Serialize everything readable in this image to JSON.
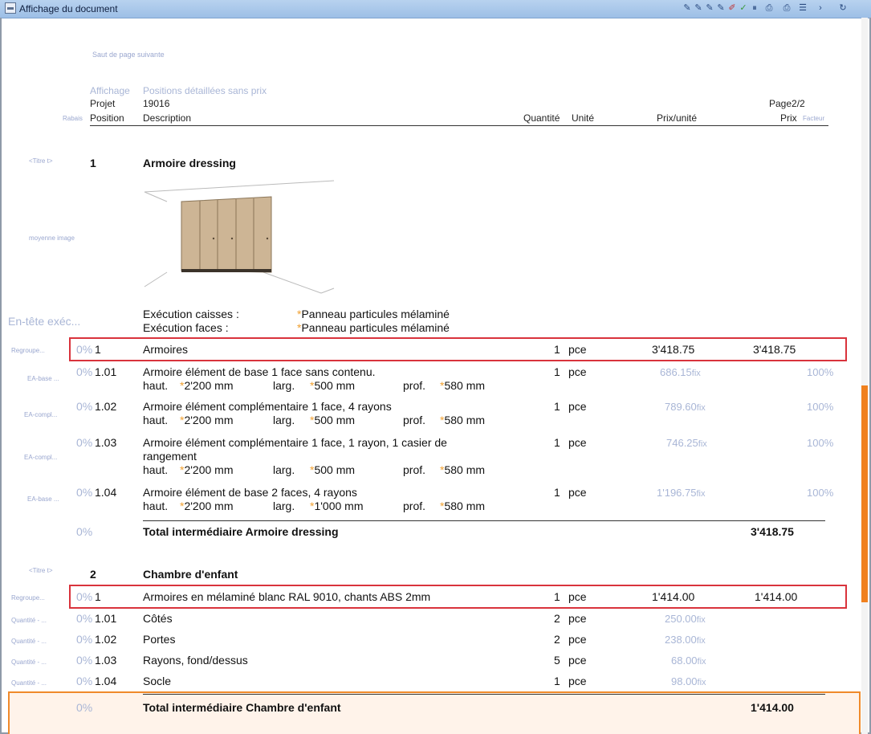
{
  "window": {
    "title": "Affichage du document"
  },
  "page": {
    "page_break": "Saut de page suivante",
    "display_label": "Affichage",
    "display_value": "Positions détaillées sans prix",
    "project_label": "Projet",
    "project_value": "19016",
    "page_number": "Page2/2",
    "col_rabais": "Rabais",
    "col_position": "Position",
    "col_description": "Description",
    "col_quantity": "Quantité",
    "col_unit": "Unité",
    "col_unit_price": "Prix/unité",
    "col_price": "Prix",
    "col_factor": "Facteur"
  },
  "sections": [
    {
      "side_label": "<Titre t>",
      "number": "1",
      "title": "Armoire dressing",
      "image_label": "moyenne image",
      "exec_header": "En-tête exéc...",
      "exec_lines": [
        {
          "label": "Exécution caisses :",
          "star": "*",
          "value": "Panneau particules mélaminé"
        },
        {
          "label": "Exécution faces :",
          "star": "*",
          "value": "Panneau particules mélaminé"
        }
      ],
      "rows": [
        {
          "side": "Regroupe...",
          "rabais": "0%",
          "pos": "1",
          "line1": "Armoires",
          "qty": "1",
          "unit": "pce",
          "unit_price": "3'418.75",
          "price": "3'418.75"
        },
        {
          "side": "EA-base ...",
          "rabais": "0%",
          "pos": "1.01",
          "line1": "Armoire élément de base 1 face sans contenu.",
          "dims": {
            "h_label": "haut.",
            "h": "2'200 mm",
            "l_label": "larg.",
            "l": "500 mm",
            "p_label": "prof.",
            "p": "580 mm"
          },
          "qty": "1",
          "unit": "pce",
          "unit_price": "686.15",
          "fix": "fix",
          "factor": "100%"
        },
        {
          "side": "EA-compl...",
          "rabais": "0%",
          "pos": "1.02",
          "line1": "Armoire élément complémentaire 1 face, 4 rayons",
          "dims": {
            "h_label": "haut.",
            "h": "2'200 mm",
            "l_label": "larg.",
            "l": "500 mm",
            "p_label": "prof.",
            "p": "580 mm"
          },
          "qty": "1",
          "unit": "pce",
          "unit_price": "789.60",
          "fix": "fix",
          "factor": "100%"
        },
        {
          "side": "EA-compl...",
          "rabais": "0%",
          "pos": "1.03",
          "line1": "Armoire élément complémentaire 1 face, 1 rayon, 1 casier de",
          "line2": "rangement",
          "dims": {
            "h_label": "haut.",
            "h": "2'200 mm",
            "l_label": "larg.",
            "l": "500 mm",
            "p_label": "prof.",
            "p": "580 mm"
          },
          "qty": "1",
          "unit": "pce",
          "unit_price": "746.25",
          "fix": "fix",
          "factor": "100%"
        },
        {
          "side": "EA-base ...",
          "rabais": "0%",
          "pos": "1.04",
          "line1": "Armoire élément de base 2 faces, 4 rayons",
          "dims": {
            "h_label": "haut.",
            "h": "2'200 mm",
            "l_label": "larg.",
            "l": "1'000 mm",
            "p_label": "prof.",
            "p": "580 mm"
          },
          "qty": "1",
          "unit": "pce",
          "unit_price": "1'196.75",
          "fix": "fix",
          "factor": "100%"
        }
      ],
      "subtotal": {
        "rabais": "0%",
        "label": "Total intermédiaire Armoire dressing",
        "value": "3'418.75"
      }
    },
    {
      "side_label": "<Titre t>",
      "number": "2",
      "title": "Chambre d'enfant",
      "rows": [
        {
          "side": "Regroupe...",
          "rabais": "0%",
          "pos": "1",
          "line1": "Armoires en mélaminé blanc RAL 9010, chants ABS 2mm",
          "qty": "1",
          "unit": "pce",
          "unit_price": "1'414.00",
          "price": "1'414.00"
        },
        {
          "side": "Quantité - ...",
          "rabais": "0%",
          "pos": "1.01",
          "line1": "Côtés",
          "qty": "2",
          "unit": "pce",
          "unit_price": "250.00",
          "fix": "fix"
        },
        {
          "side": "Quantité - ...",
          "rabais": "0%",
          "pos": "1.02",
          "line1": "Portes",
          "qty": "2",
          "unit": "pce",
          "unit_price": "238.00",
          "fix": "fix"
        },
        {
          "side": "Quantité - ...",
          "rabais": "0%",
          "pos": "1.03",
          "line1": "Rayons, fond/dessus",
          "qty": "5",
          "unit": "pce",
          "unit_price": "68.00",
          "fix": "fix"
        },
        {
          "side": "Quantité - ...",
          "rabais": "0%",
          "pos": "1.04",
          "line1": "Socle",
          "qty": "1",
          "unit": "pce",
          "unit_price": "98.00",
          "fix": "fix"
        }
      ],
      "subtotal": {
        "rabais": "0%",
        "label": "Total intermédiaire Chambre d'enfant",
        "value": "1'414.00"
      }
    }
  ]
}
